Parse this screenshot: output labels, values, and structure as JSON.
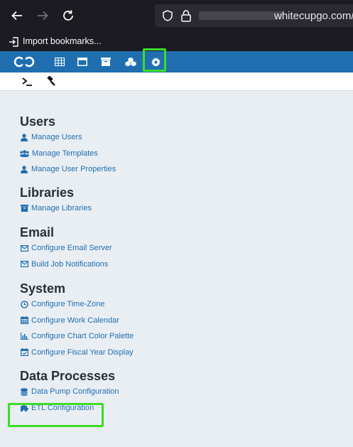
{
  "browser": {
    "url_domain": "whitecupgo.com/",
    "bookmark_label": "Import bookmarks..."
  },
  "colors": {
    "brand_blue": "#1f6fb0",
    "highlight_green": "#3ddc2a",
    "link_blue": "#1f6fb0"
  },
  "sections": [
    {
      "title": "Users",
      "links": [
        "Manage Users",
        "Manage Templates",
        "Manage User Properties"
      ]
    },
    {
      "title": "Libraries",
      "links": [
        "Manage Libraries"
      ]
    },
    {
      "title": "Email",
      "links": [
        "Configure Email Server",
        "Build Job Notifications"
      ]
    },
    {
      "title": "System",
      "links": [
        "Configure Time-Zone",
        "Configure Work Calendar",
        "Configure Chart Color Palette",
        "Configure Fiscal Year Display"
      ]
    },
    {
      "title": "Data Processes",
      "links": [
        "Data Pump Configuration",
        "ETL Configuration"
      ]
    }
  ]
}
